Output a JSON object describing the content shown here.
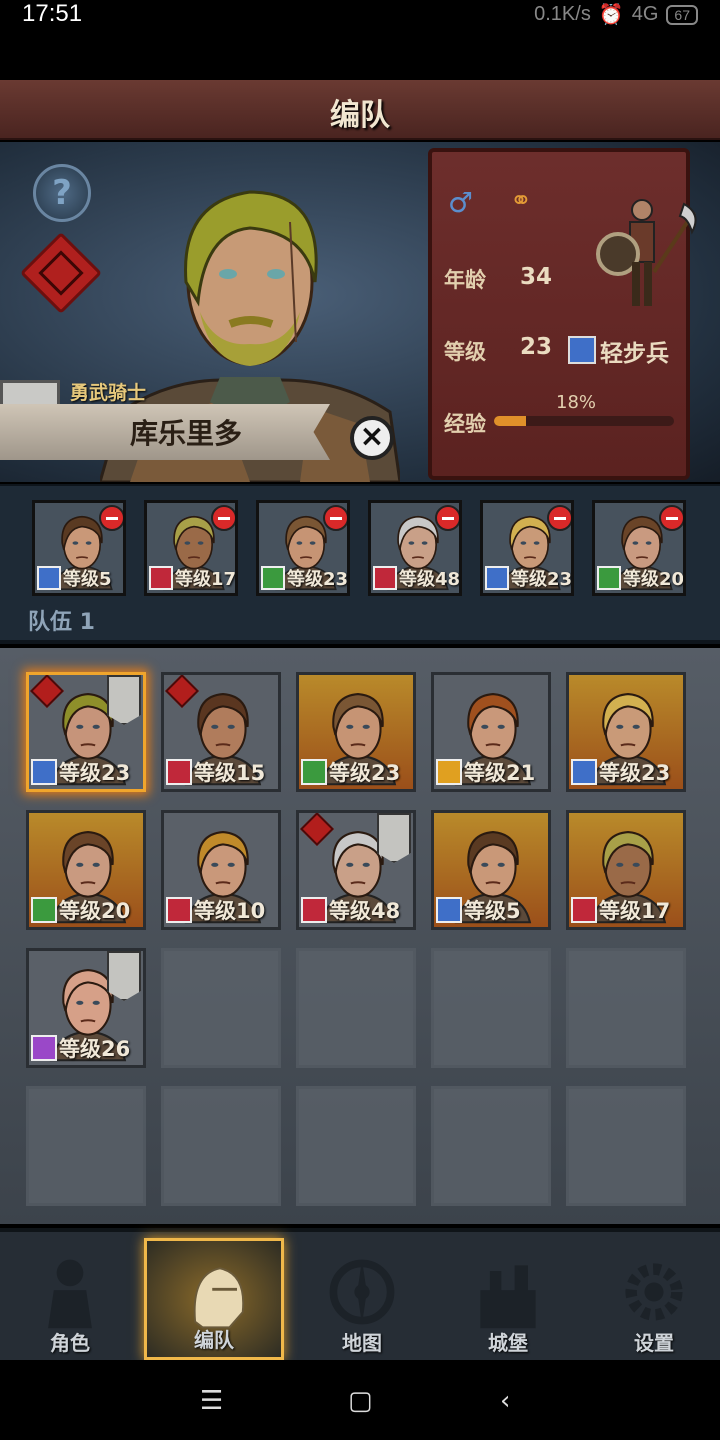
{
  "status_bar": {
    "time": "17:51",
    "network": "0.1K/s",
    "signal": "4G",
    "battery": "67"
  },
  "header": {
    "title": "编队"
  },
  "hero": {
    "title": "勇武骑士",
    "name": "库乐里多",
    "gender_icon": "male-icon",
    "age_label": "年龄",
    "age": "34",
    "level_label": "等级",
    "level": "23",
    "class_name": "轻步兵",
    "xp_label": "经验",
    "xp_percent": "18%",
    "xp_fraction": 0.18
  },
  "team": {
    "name": "队伍 1",
    "members": [
      {
        "level": "等级5",
        "class": "sword",
        "color": "#3f6fc8",
        "skin": "#c99878",
        "hair": "#5a3a22"
      },
      {
        "level": "等级17",
        "class": "cavalry",
        "color": "#c0283a",
        "skin": "#9a6a48",
        "hair": "#a8a048"
      },
      {
        "level": "等级23",
        "class": "archer",
        "color": "#3b9a3e",
        "skin": "#c69474",
        "hair": "#7a5634"
      },
      {
        "level": "等级48",
        "class": "cavalry",
        "color": "#c0283a",
        "skin": "#c9a088",
        "hair": "#c8c8c8"
      },
      {
        "level": "等级23",
        "class": "sword",
        "color": "#3f6fc8",
        "skin": "#c99a78",
        "hair": "#d2b050"
      },
      {
        "level": "等级20",
        "class": "archer",
        "color": "#3b9a3e",
        "skin": "#c99a80",
        "hair": "#6a4428"
      }
    ]
  },
  "roster": {
    "characters": [
      {
        "level": "等级23",
        "class": "sword",
        "color": "#3f6fc8",
        "skin": "#c6947a",
        "hair": "#8e8f2a",
        "bg": "gray",
        "selected": true,
        "flag": true,
        "knot": true
      },
      {
        "level": "等级15",
        "class": "cavalry",
        "color": "#c0283a",
        "skin": "#b07c5c",
        "hair": "#5a3620",
        "bg": "gray",
        "selected": false,
        "flag": false,
        "knot": true
      },
      {
        "level": "等级23",
        "class": "archer",
        "color": "#3b9a3e",
        "skin": "#c69474",
        "hair": "#7a5634",
        "bg": "orange",
        "selected": false,
        "flag": false,
        "knot": false
      },
      {
        "level": "等级21",
        "class": "shield",
        "color": "#e0a020",
        "skin": "#c9987a",
        "hair": "#a0501e",
        "bg": "gray",
        "selected": false,
        "flag": false,
        "knot": false
      },
      {
        "level": "等级23",
        "class": "sword",
        "color": "#3f6fc8",
        "skin": "#c99a78",
        "hair": "#d2b050",
        "bg": "orange",
        "selected": false,
        "flag": false,
        "knot": false
      },
      {
        "level": "等级20",
        "class": "archer",
        "color": "#3b9a3e",
        "skin": "#c99a80",
        "hair": "#6a4428",
        "bg": "orange",
        "selected": false,
        "flag": false,
        "knot": false
      },
      {
        "level": "等级10",
        "class": "cavalry",
        "color": "#c0283a",
        "skin": "#c9987a",
        "hair": "#c08a2a",
        "bg": "gray",
        "selected": false,
        "flag": false,
        "knot": false
      },
      {
        "level": "等级48",
        "class": "cavalry",
        "color": "#c0283a",
        "skin": "#c9a088",
        "hair": "#c8c8c8",
        "bg": "gray",
        "selected": false,
        "flag": true,
        "knot": true
      },
      {
        "level": "等级5",
        "class": "sword",
        "color": "#3f6fc8",
        "skin": "#c99878",
        "hair": "#5a3a22",
        "bg": "orange",
        "selected": false,
        "flag": false,
        "knot": false
      },
      {
        "level": "等级17",
        "class": "cavalry",
        "color": "#c0283a",
        "skin": "#9a6a48",
        "hair": "#a8a048",
        "bg": "orange",
        "selected": false,
        "flag": false,
        "knot": false
      },
      {
        "level": "等级26",
        "class": "mage",
        "color": "#9a48c8",
        "skin": "#d6a088",
        "hair": "#d6a088",
        "bg": "gray",
        "selected": false,
        "flag": true,
        "knot": false
      }
    ],
    "empty_slots": 9
  },
  "nav": {
    "items": [
      {
        "label": "角色",
        "icon": "knight-icon",
        "active": false
      },
      {
        "label": "编队",
        "icon": "helmet-icon",
        "active": true
      },
      {
        "label": "地图",
        "icon": "compass-icon",
        "active": false
      },
      {
        "label": "城堡",
        "icon": "castle-icon",
        "active": false
      },
      {
        "label": "设置",
        "icon": "gear-icon",
        "active": false
      }
    ]
  }
}
